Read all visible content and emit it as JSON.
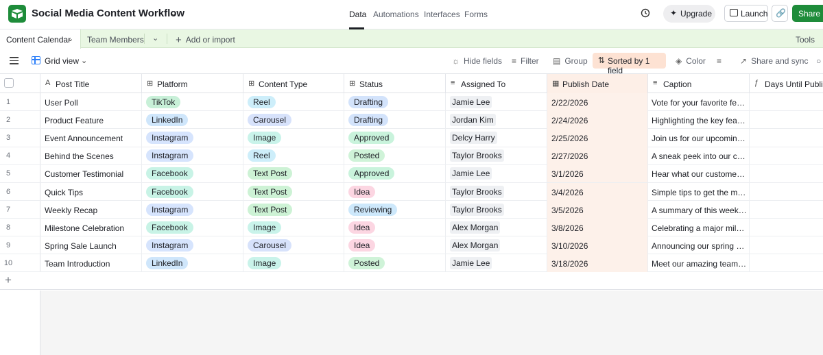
{
  "app": {
    "base_title": "Social Media Content Workflow",
    "nav_tabs": [
      "Data",
      "Automations",
      "Interfaces",
      "Forms"
    ],
    "upgrade_label": "Upgrade",
    "launch_label": "Launch",
    "share_label": "Share"
  },
  "tables": {
    "active": "Content Calendar",
    "other": "Team Members",
    "add_import": "Add or import",
    "tools": "Tools"
  },
  "view": {
    "name": "Grid view",
    "hide_fields": "Hide fields",
    "filter": "Filter",
    "group": "Group",
    "sorted": "Sorted by 1 field",
    "color": "Color",
    "share_sync": "Share and sync"
  },
  "columns": [
    {
      "label": "Post Title",
      "icon": "text-icon"
    },
    {
      "label": "Platform",
      "icon": "single-select-icon"
    },
    {
      "label": "Content Type",
      "icon": "single-select-icon"
    },
    {
      "label": "Status",
      "icon": "single-select-icon"
    },
    {
      "label": "Assigned To",
      "icon": "user-icon"
    },
    {
      "label": "Publish Date",
      "icon": "calendar-icon"
    },
    {
      "label": "Caption",
      "icon": "long-text-icon"
    },
    {
      "label": "Days Until Publish",
      "icon": "formula-icon"
    }
  ],
  "rows": [
    {
      "num": "1",
      "title": "User Poll",
      "platform": "TikTok",
      "type": "Reel",
      "status": "Drafting",
      "assigned": "Jamie Lee",
      "date": "2/22/2026",
      "caption": "Vote for your favorite featu..."
    },
    {
      "num": "2",
      "title": "Product Feature",
      "platform": "LinkedIn",
      "type": "Carousel",
      "status": "Drafting",
      "assigned": "Jordan Kim",
      "date": "2/24/2026",
      "caption": "Highlighting the key featur..."
    },
    {
      "num": "3",
      "title": "Event Announcement",
      "platform": "Instagram",
      "type": "Image",
      "status": "Approved",
      "assigned": "Delcy Harry",
      "date": "2/25/2026",
      "caption": "Join us for our upcoming vi..."
    },
    {
      "num": "4",
      "title": "Behind the Scenes",
      "platform": "Instagram",
      "type": "Reel",
      "status": "Posted",
      "assigned": "Taylor Brooks",
      "date": "2/27/2026",
      "caption": "A sneak peek into our creat..."
    },
    {
      "num": "5",
      "title": "Customer Testimonial",
      "platform": "Facebook",
      "type": "Text Post",
      "status": "Approved",
      "assigned": "Jamie Lee",
      "date": "3/1/2026",
      "caption": "Hear what our customers h..."
    },
    {
      "num": "6",
      "title": "Quick Tips",
      "platform": "Facebook",
      "type": "Text Post",
      "status": "Idea",
      "assigned": "Taylor Brooks",
      "date": "3/4/2026",
      "caption": "Simple tips to get the most..."
    },
    {
      "num": "7",
      "title": "Weekly Recap",
      "platform": "Instagram",
      "type": "Text Post",
      "status": "Reviewing",
      "assigned": "Taylor Brooks",
      "date": "3/5/2026",
      "caption": "A summary of this week's h..."
    },
    {
      "num": "8",
      "title": "Milestone Celebration",
      "platform": "Facebook",
      "type": "Image",
      "status": "Idea",
      "assigned": "Alex Morgan",
      "date": "3/8/2026",
      "caption": "Celebrating a major milest..."
    },
    {
      "num": "9",
      "title": "Spring Sale Launch",
      "platform": "Instagram",
      "type": "Carousel",
      "status": "Idea",
      "assigned": "Alex Morgan",
      "date": "3/10/2026",
      "caption": "Announcing our spring sale..."
    },
    {
      "num": "10",
      "title": "Team Introduction",
      "platform": "LinkedIn",
      "type": "Image",
      "status": "Posted",
      "assigned": "Jamie Lee",
      "date": "3/18/2026",
      "caption": "Meet our amazing team m..."
    }
  ],
  "colors": {
    "brand": "#1e8c3a",
    "tabs_bar": "#e9f7e3",
    "sorted_highlight": "#fde2d3",
    "platform": {
      "TikTok": "#c8f0d8",
      "LinkedIn": "#cfe6fb",
      "Instagram": "#d6e4fd",
      "Facebook": "#c8f3e6"
    },
    "type": {
      "Reel": "#cdeefa",
      "Carousel": "#d7e2fb",
      "Image": "#c9f3ea",
      "Text Post": "#cdf2d5"
    },
    "status": {
      "Drafting": "#d3e3fb",
      "Approved": "#c9f3dc",
      "Posted": "#cff3d8",
      "Idea": "#fcd6e2",
      "Reviewing": "#cde8fb"
    }
  }
}
